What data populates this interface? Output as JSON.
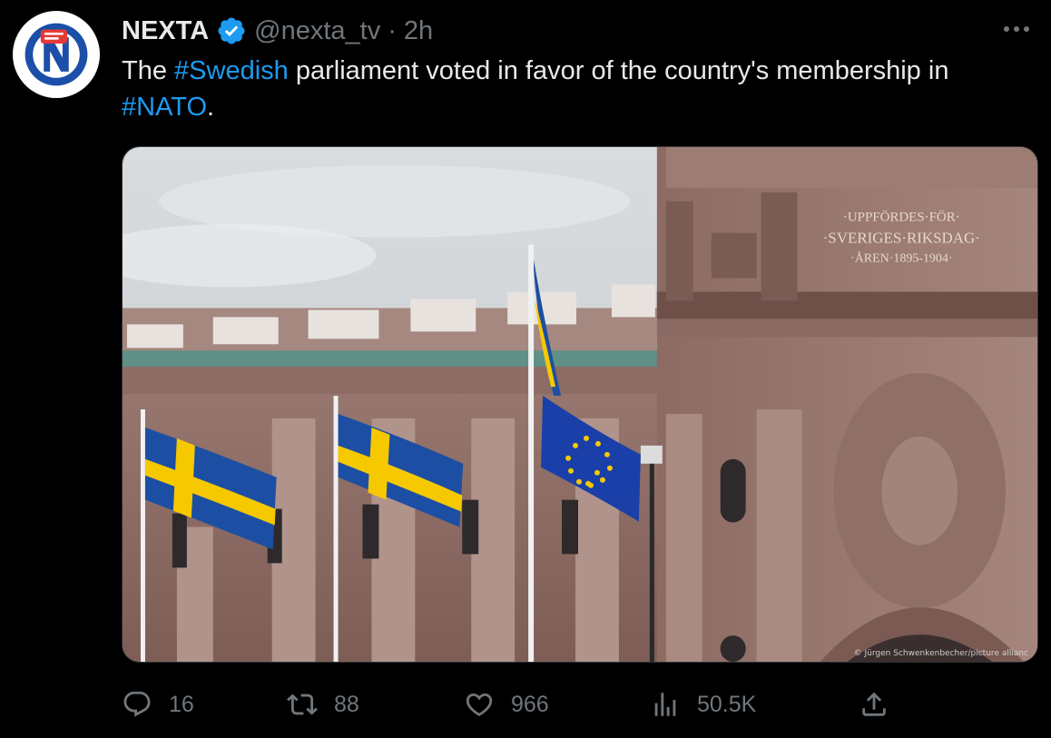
{
  "tweet": {
    "author_name": "NEXTA",
    "handle": "@nexta_tv",
    "separator": "·",
    "time": "2h",
    "text_parts": [
      "The ",
      "#Swedish",
      " parliament voted in favor of the country's membership in ",
      "#NATO",
      "."
    ],
    "image": {
      "inscription_line1": "·UPPFÖRDES·FÖR·",
      "inscription_line2": "·SVERIGES·RIKSDAG·",
      "inscription_line3": "·ÅREN·1895-1904·",
      "credit": "© Jürgen Schwenkenbecher/picture allianc"
    }
  },
  "actions": {
    "reply_count": "16",
    "retweet_count": "88",
    "like_count": "966",
    "view_count": "50.5K"
  },
  "colors": {
    "background": "#000000",
    "text": "#e7e9ea",
    "muted": "#71767b",
    "link": "#1d9bf0",
    "verified": "#1d9bf0"
  },
  "icons": [
    "nexta-logo-icon",
    "verified-badge-icon",
    "more-icon",
    "reply-icon",
    "retweet-icon",
    "like-icon",
    "views-icon",
    "share-icon"
  ]
}
